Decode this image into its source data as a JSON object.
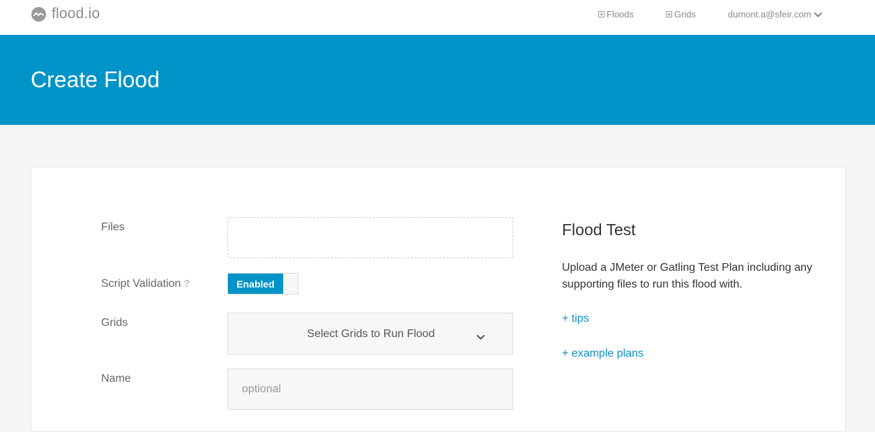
{
  "nav": {
    "logo_text": "flood.io",
    "links": [
      {
        "label": "Floods",
        "icon": "plus-square-icon"
      },
      {
        "label": "Grids",
        "icon": "plus-square-icon"
      }
    ],
    "user_email": "dumont.a@sfeir.com",
    "user_menu_icon": "chevron-down-icon"
  },
  "banner": {
    "title": "Create Flood",
    "color": "#0093c8"
  },
  "form": {
    "files_label": "Files",
    "script_validation_label": "Script Validation",
    "script_validation_help": "?",
    "toggle_label": "Enabled",
    "grids_label": "Grids",
    "grids_select_text": "Select Grids to Run Flood",
    "name_label": "Name",
    "name_placeholder": "optional"
  },
  "sidebar": {
    "title": "Flood Test",
    "description": "Upload a JMeter or Gatling Test Plan including any supporting files to run this flood with.",
    "tips_link": "+ tips",
    "examples_link": "+ example plans"
  },
  "colors": {
    "accent": "#0093c8",
    "link": "#0a8ed0",
    "page_bg": "#f5f5f5"
  }
}
